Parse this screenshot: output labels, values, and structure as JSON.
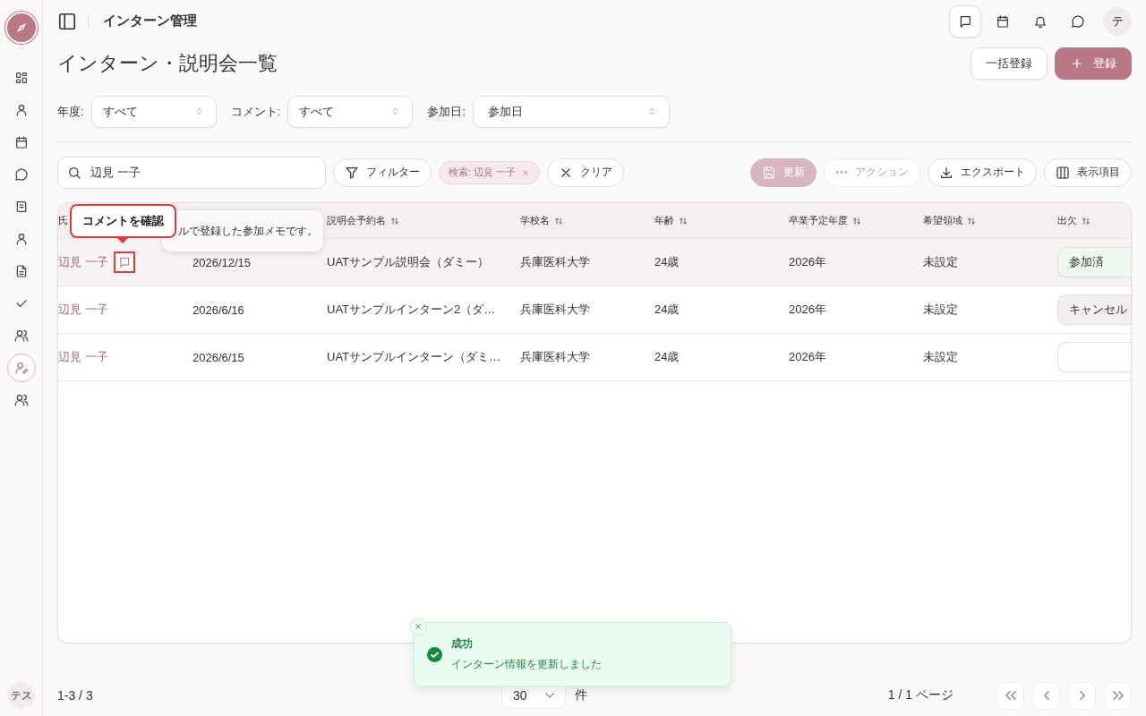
{
  "app": {
    "title": "インターン管理",
    "user_initial": "テ",
    "sidebar_user": "テス"
  },
  "sidebar": {
    "items": [
      {
        "kind": "grid",
        "selected": false
      },
      {
        "kind": "person",
        "selected": false
      },
      {
        "kind": "calendar",
        "selected": false
      },
      {
        "kind": "chat",
        "selected": false
      },
      {
        "kind": "book",
        "selected": false
      },
      {
        "kind": "person",
        "selected": false
      },
      {
        "kind": "document",
        "selected": false
      },
      {
        "kind": "check",
        "selected": false
      },
      {
        "kind": "people",
        "selected": false
      },
      {
        "kind": "person-edit",
        "selected": true
      },
      {
        "kind": "people",
        "selected": false
      }
    ]
  },
  "header_actions": [
    {
      "kind": "message",
      "selected": true
    },
    {
      "kind": "calendar",
      "selected": false
    },
    {
      "kind": "bell",
      "selected": false
    },
    {
      "kind": "chat",
      "selected": false
    }
  ],
  "page": {
    "title": "インターン・説明会一覧",
    "buttons": [
      {
        "label": "一括登録",
        "kind": "secondary"
      },
      {
        "label": "登録",
        "kind": "primary"
      }
    ]
  },
  "filters": [
    {
      "label": "年度:",
      "value": "すべて",
      "kind": "narrow"
    },
    {
      "label": "コメント:",
      "value": "すべて",
      "kind": "narrow"
    },
    {
      "label": "参加日:",
      "value": "参加日",
      "kind": "wide"
    }
  ],
  "search": {
    "value": "辺見 一子"
  },
  "toolbar": {
    "filter": "フィルター",
    "chip": "検索: 辺見 一子",
    "clear": "クリア",
    "actions": [
      {
        "label": "更新",
        "kind": "save",
        "disabled": true
      },
      {
        "label": "アクション",
        "kind": "more",
        "disabled": true
      },
      {
        "label": "エクスポート",
        "kind": "download",
        "disabled": false
      },
      {
        "label": "表示項目",
        "kind": "columns",
        "disabled": false
      }
    ]
  },
  "table": {
    "columns": [
      {
        "label": "氏"
      },
      {},
      {
        "label": "説明会予約名",
        "sort": true
      },
      {
        "label": "学校名",
        "sort": true
      },
      {
        "label": "年齢",
        "sort": true
      },
      {
        "label": "卒業予定年度",
        "sort": true
      },
      {
        "label": "希望領域",
        "sort": true
      },
      {
        "label": "出欠",
        "sort": true
      }
    ],
    "rows": [
      {
        "selected": true,
        "name": "辺見 一子",
        "comment": true,
        "highlighted": true,
        "date": "2026/12/15",
        "event": "UATサンプル説明会（ダミー）",
        "school": "兵庫医科大学",
        "age": "24歳",
        "grad": "2026年",
        "area": "未設定",
        "attendance": {
          "label": "参加済",
          "kind": "attended"
        }
      },
      {
        "selected": false,
        "name": "辺見 一子",
        "comment": false,
        "date": "2026/6/16",
        "event": "UATサンプルインターン2（ダ…",
        "school": "兵庫医科大学",
        "age": "24歳",
        "grad": "2026年",
        "area": "未設定",
        "attendance": {
          "label": "キャンセル",
          "kind": "cancelled"
        }
      },
      {
        "selected": false,
        "name": "辺見 一子",
        "comment": false,
        "date": "2026/6/15",
        "event": "UATサンプルインターン（ダミ…",
        "school": "兵庫医科大学",
        "age": "24歳",
        "grad": "2026年",
        "area": "未設定",
        "attendance": {
          "kind": "none"
        }
      }
    ]
  },
  "guide": {
    "callout": "コメントを確認",
    "tooltip": "ルで登録した参加メモです。"
  },
  "footer": {
    "range": "1-3 / 3",
    "page_size": "30",
    "unit": "件",
    "page": "1 / 1 ページ"
  },
  "toast": {
    "title": "成功",
    "message": "インターン情報を更新しました"
  }
}
